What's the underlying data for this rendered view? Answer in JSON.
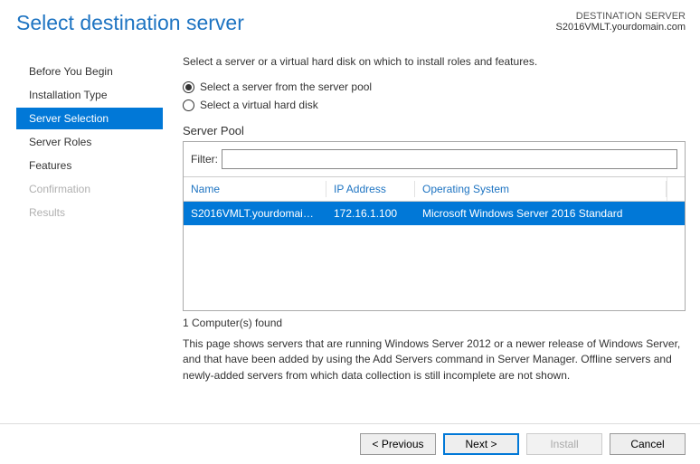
{
  "header": {
    "title": "Select destination server",
    "dest_label": "DESTINATION SERVER",
    "dest_server": "S2016VMLT.yourdomain.com"
  },
  "sidebar": {
    "items": [
      {
        "label": "Before You Begin",
        "state": "normal"
      },
      {
        "label": "Installation Type",
        "state": "normal"
      },
      {
        "label": "Server Selection",
        "state": "active"
      },
      {
        "label": "Server Roles",
        "state": "normal"
      },
      {
        "label": "Features",
        "state": "normal"
      },
      {
        "label": "Confirmation",
        "state": "disabled"
      },
      {
        "label": "Results",
        "state": "disabled"
      }
    ]
  },
  "main": {
    "instruction": "Select a server or a virtual hard disk on which to install roles and features.",
    "radios": {
      "pool": "Select a server from the server pool",
      "vhd": "Select a virtual hard disk",
      "selected": "pool"
    },
    "pool_label": "Server Pool",
    "filter_label": "Filter:",
    "filter_value": "",
    "columns": {
      "name": "Name",
      "ip": "IP Address",
      "os": "Operating System"
    },
    "rows": [
      {
        "name": "S2016VMLT.yourdomain....",
        "ip": "172.16.1.100",
        "os": "Microsoft Windows Server 2016 Standard",
        "selected": true
      }
    ],
    "count_text": "1 Computer(s) found",
    "help_text": "This page shows servers that are running Windows Server 2012 or a newer release of Windows Server, and that have been added by using the Add Servers command in Server Manager. Offline servers and newly-added servers from which data collection is still incomplete are not shown."
  },
  "footer": {
    "previous": "< Previous",
    "next": "Next >",
    "install": "Install",
    "cancel": "Cancel"
  }
}
